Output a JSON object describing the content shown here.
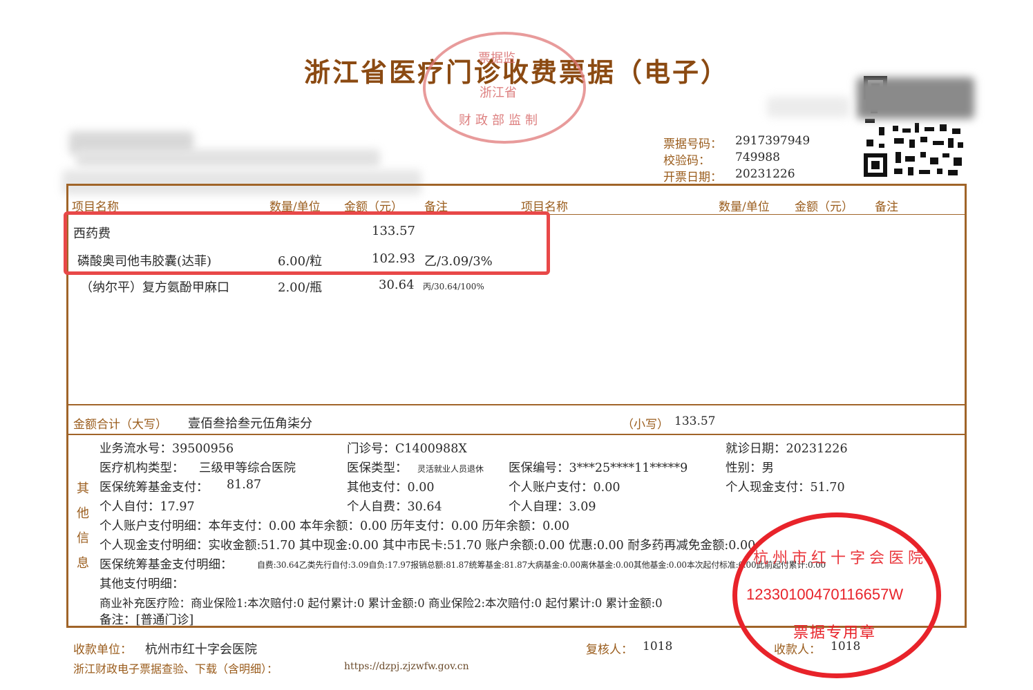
{
  "title": "浙江省医疗门诊收费票据（电子）",
  "stamp_top": {
    "line1": "票据监",
    "line2": "浙江省",
    "line3": "财政部监制"
  },
  "stamp_bottom": {
    "arc": "杭州市红十字会医院",
    "code": "12330100470116657W",
    "label": "票据专用章"
  },
  "header": {
    "bill_no_label": "票据号码：",
    "bill_no": "2917397949",
    "check_code_label": "校验码：",
    "check_code": "749988",
    "issue_date_label": "开票日期：",
    "issue_date": "20231226"
  },
  "table": {
    "columns_left": {
      "name": "项目名称",
      "qty": "数量/单位",
      "amount": "金额（元）",
      "note": "备注"
    },
    "columns_right": {
      "name": "项目名称",
      "qty": "数量/单位",
      "amount": "金额（元）",
      "note": "备注"
    },
    "rows": [
      {
        "name": "西药费",
        "qty": "",
        "amount": "133.57",
        "note": ""
      },
      {
        "name": "磷酸奥司他韦胶囊(达菲)",
        "qty": "6.00/粒",
        "amount": "102.93",
        "note": "乙/3.09/3%"
      },
      {
        "name": "（纳尔平）复方氨酚甲麻口",
        "qty": "2.00/瓶",
        "amount": "30.64",
        "note": "丙/30.64/100%"
      }
    ]
  },
  "total": {
    "upper_label": "金额合计（大写）",
    "upper_value": "壹佰叁拾叁元伍角柒分",
    "lower_label": "（小写）",
    "lower_value": "133.57"
  },
  "other_info": {
    "side_label": "其他信息",
    "serial": "业务流水号：39500956",
    "clinic_no": "门诊号：C1400988X",
    "visit_date": "就诊日期：20231226",
    "inst_type_label": "医疗机构类型：",
    "inst_type": "三级甲等综合医院",
    "ins_type_label": "医保类型：",
    "ins_type": "灵活就业人员退休",
    "ins_no": "医保编号：3***25****11*****9",
    "gender": "性别：男",
    "fund_pay_label": "医保统筹基金支付：",
    "fund_pay": "81.87",
    "other_pay": "其他支付：0.00",
    "account_pay": "个人账户支付：0.00",
    "cash_pay": "个人现金支付：51.70",
    "self_pay": "个人自付：17.97",
    "self_fee": "个人自费：30.64",
    "self_manage": "个人自理：3.09",
    "account_detail": "个人账户支付明细：本年支付：0.00 本年余额：0.00 历年支付：0.00 历年余额：0.00",
    "cash_detail": "个人现金支付明细：实收金额:51.70 其中现金:0.00 其中市民卡:51.70 账户余额:0.00 优惠:0.00 耐多药再减免金额:0.00",
    "fund_detail_label": "医保统筹基金支付明细：",
    "fund_detail": "自费:30.64乙类先行自付:3.09自负:17.97报销总额:81.87统筹基金:81.87大病基金:0.00离休基金:0.00其他基金:0.00本次起付标准:0.00此前起付累计:0.00",
    "other_detail": "其他支付明细：",
    "commercial": "商业补充医疗险：商业保险1:本次赔付:0 起付累计:0 累计金额:0 商业保险2:本次赔付:0 起付累计:0 累计金额:0",
    "remark": "备注：[普通门诊]"
  },
  "footer": {
    "payee_label": "收款单位：",
    "payee": "杭州市红十字会医院",
    "reviewer_label": "复核人：",
    "reviewer": "1018",
    "cashier_label": "收款人：",
    "cashier": "1018",
    "query_label": "浙江财政电子票据查验、下载（含明细）：",
    "query_url": "https://dzpj.zjzwfw.gov.cn"
  }
}
